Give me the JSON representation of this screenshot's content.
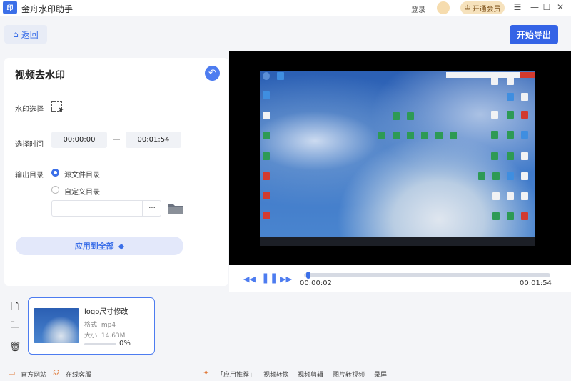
{
  "app": {
    "logo_text": "印",
    "title": "金舟水印助手"
  },
  "titlebar": {
    "login": "登录",
    "vip": "开通会员",
    "menu_icon": "☰",
    "min_icon": "—",
    "max_icon": "☐",
    "close_icon": "✕"
  },
  "toolbar": {
    "back_label": "返回",
    "export_label": "开始导出"
  },
  "panel": {
    "title": "视频去水印",
    "watermark_select_label": "水印选择",
    "time_label": "选择时间",
    "start_time": "00:00:00",
    "end_time": "00:01:54",
    "output_label": "输出目录",
    "output_options": [
      "源文件目录",
      "自定义目录"
    ],
    "selected_output": "源文件目录",
    "path_value": "",
    "dots": "···",
    "apply_label": "应用到全部"
  },
  "player": {
    "current_time": "00:00:02",
    "total_time": "00:01:54",
    "progress_fraction": 0.017
  },
  "files": [
    {
      "name": "logo尺寸修改",
      "format": "格式: mp4",
      "size": "大小: 14.63M",
      "progress": "0%"
    }
  ],
  "footer": {
    "official_site": "官方网站",
    "online_service": "在线客服",
    "app_recommend": "「应用推荐」",
    "links": [
      "视频转换",
      "视频剪辑",
      "图片转视频",
      "录屏"
    ]
  },
  "colors": {
    "accent": "#3b6fe8",
    "export_bg": "#3463e6",
    "vip_bg": "#f6e2bd"
  }
}
